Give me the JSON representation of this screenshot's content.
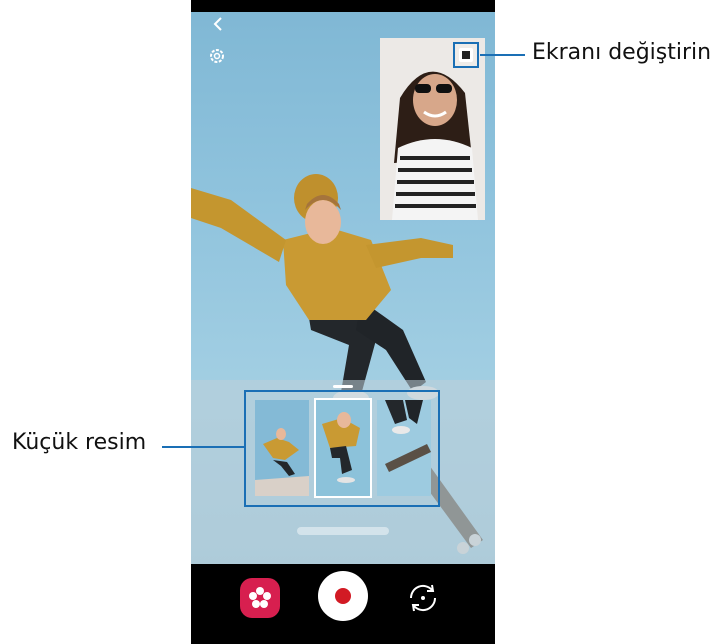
{
  "callouts": {
    "switch_screen": "Ekranı değiştirin",
    "thumbnail": "Küçük resim"
  },
  "icons": {
    "back": "chevron-left-icon",
    "settings": "gear-icon",
    "switch_screen": "picture-in-picture-icon",
    "filter": "flower-filter-icon",
    "record": "record-icon",
    "flip": "flip-camera-icon"
  },
  "colors": {
    "accent": "#1a6fb5",
    "filter_button": "#d71f4f",
    "record": "#d21a24"
  }
}
